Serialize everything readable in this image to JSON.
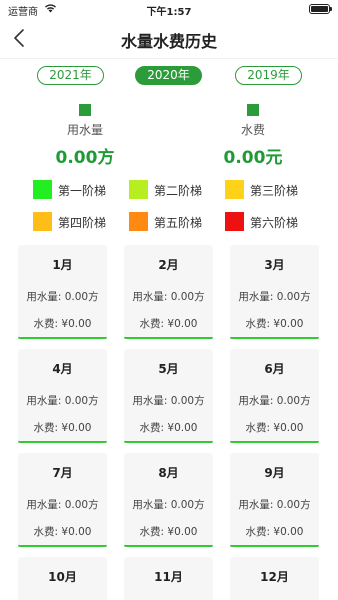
{
  "status_bar": {
    "carrier": "运营商",
    "time": "下午1:57"
  },
  "nav": {
    "title": "水量水费历史"
  },
  "year_tabs": [
    {
      "label": "2021年",
      "active": false
    },
    {
      "label": "2020年",
      "active": true
    },
    {
      "label": "2019年",
      "active": false
    }
  ],
  "summary": {
    "usage": {
      "label": "用水量",
      "value": "0.00方"
    },
    "fee": {
      "label": "水费",
      "value": "0.00元"
    }
  },
  "legend": [
    {
      "label": "第一阶梯",
      "color": "#22ee22"
    },
    {
      "label": "第二阶梯",
      "color": "#b6ee22"
    },
    {
      "label": "第三阶梯",
      "color": "#ffd21a"
    },
    {
      "label": "第四阶梯",
      "color": "#ffbd1a"
    },
    {
      "label": "第五阶梯",
      "color": "#ff8a12"
    },
    {
      "label": "第六阶梯",
      "color": "#ee1111"
    }
  ],
  "months": [
    {
      "name": "1月",
      "usage": "用水量: 0.00方",
      "fee": "水费: ¥0.00"
    },
    {
      "name": "2月",
      "usage": "用水量: 0.00方",
      "fee": "水费: ¥0.00"
    },
    {
      "name": "3月",
      "usage": "用水量: 0.00方",
      "fee": "水费: ¥0.00"
    },
    {
      "name": "4月",
      "usage": "用水量: 0.00方",
      "fee": "水费: ¥0.00"
    },
    {
      "name": "5月",
      "usage": "用水量: 0.00方",
      "fee": "水费: ¥0.00"
    },
    {
      "name": "6月",
      "usage": "用水量: 0.00方",
      "fee": "水费: ¥0.00"
    },
    {
      "name": "7月",
      "usage": "用水量: 0.00方",
      "fee": "水费: ¥0.00"
    },
    {
      "name": "8月",
      "usage": "用水量: 0.00方",
      "fee": "水费: ¥0.00"
    },
    {
      "name": "9月",
      "usage": "用水量: 0.00方",
      "fee": "水费: ¥0.00"
    },
    {
      "name": "10月"
    },
    {
      "name": "11月"
    },
    {
      "name": "12月"
    }
  ]
}
